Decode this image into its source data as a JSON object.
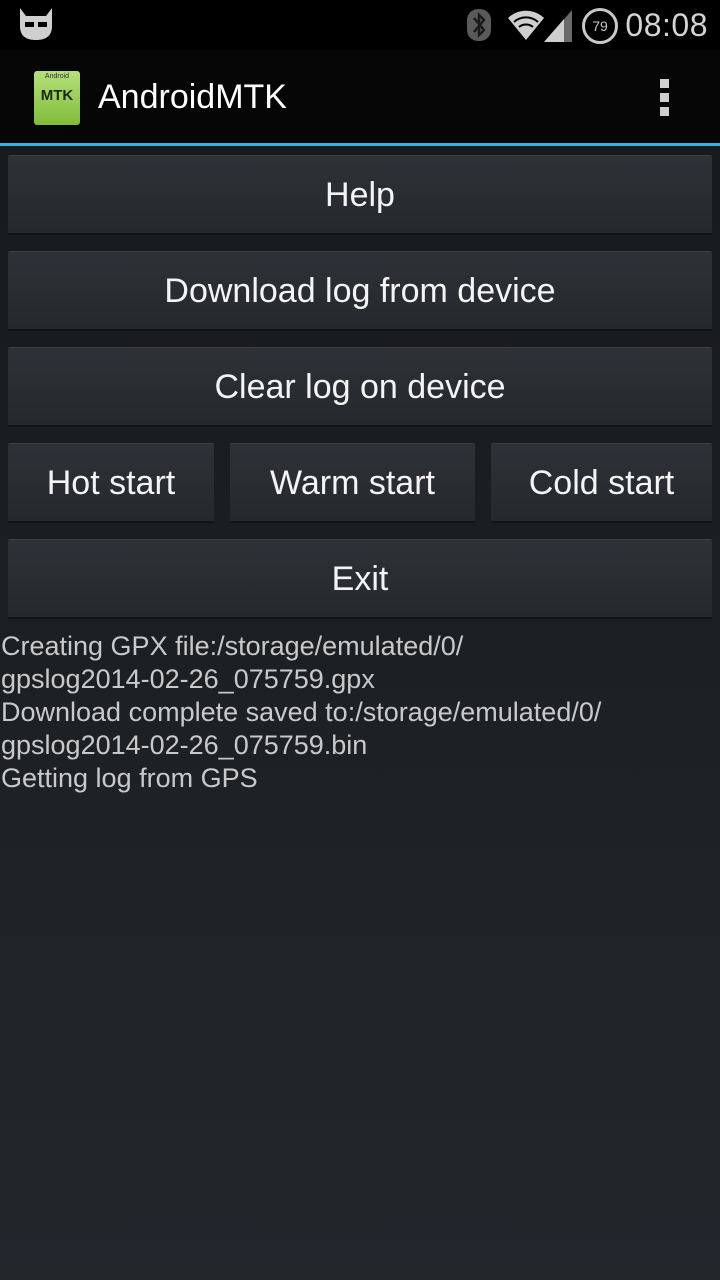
{
  "status_bar": {
    "time": "08:08",
    "battery_level": "79",
    "icons": [
      "cyanogen-android-icon",
      "bluetooth-icon",
      "wifi-icon",
      "signal-icon",
      "battery-icon"
    ]
  },
  "action_bar": {
    "app_title": "AndroidMTK",
    "app_icon_text": "MTK",
    "app_icon_subtext": "Android",
    "menu_icon": "overflow-menu-icon",
    "accent_color": "#33b5e5"
  },
  "buttons": {
    "help": "Help",
    "download": "Download log from device",
    "clear": "Clear log on device",
    "hot_start": "Hot start",
    "warm_start": "Warm start",
    "cold_start": "Cold start",
    "exit": "Exit"
  },
  "log": [
    "Creating GPX file:/storage/emulated/0/",
    "gpslog2014-02-26_075759.gpx",
    "Download complete saved to:/storage/emulated/0/",
    "gpslog2014-02-26_075759.bin",
    "Getting log from GPS"
  ]
}
